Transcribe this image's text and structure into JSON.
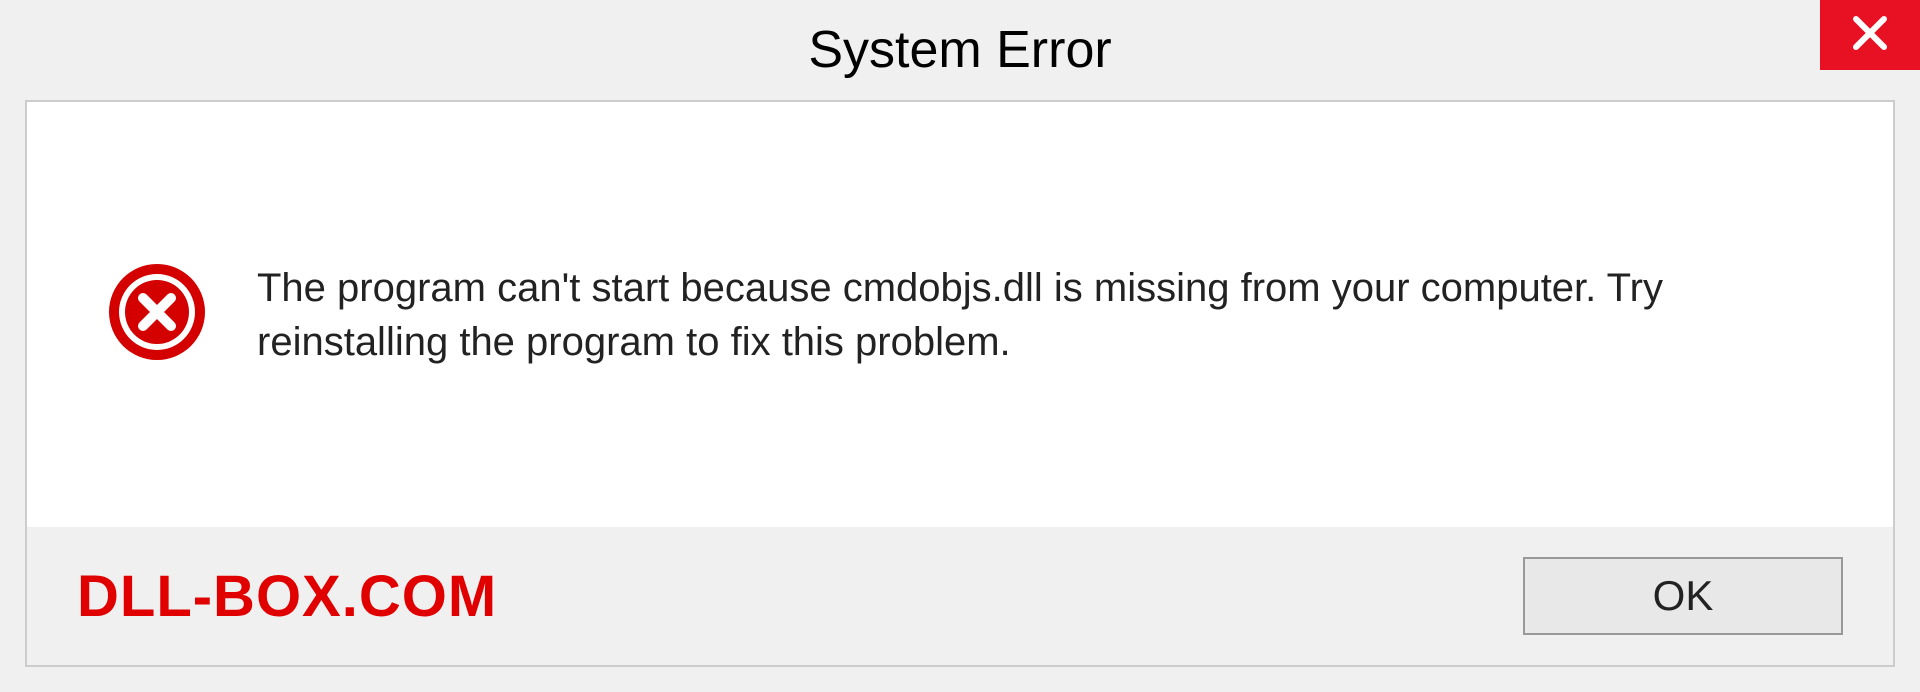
{
  "dialog": {
    "title": "System Error",
    "message": "The program can't start because cmdobjs.dll is missing from your computer. Try reinstalling the program to fix this problem.",
    "ok_label": "OK"
  },
  "watermark": "DLL-BOX.COM",
  "colors": {
    "close_red": "#e81123",
    "error_red": "#d40000",
    "watermark_red": "#e00000",
    "panel_bg": "#f0f0f0"
  }
}
